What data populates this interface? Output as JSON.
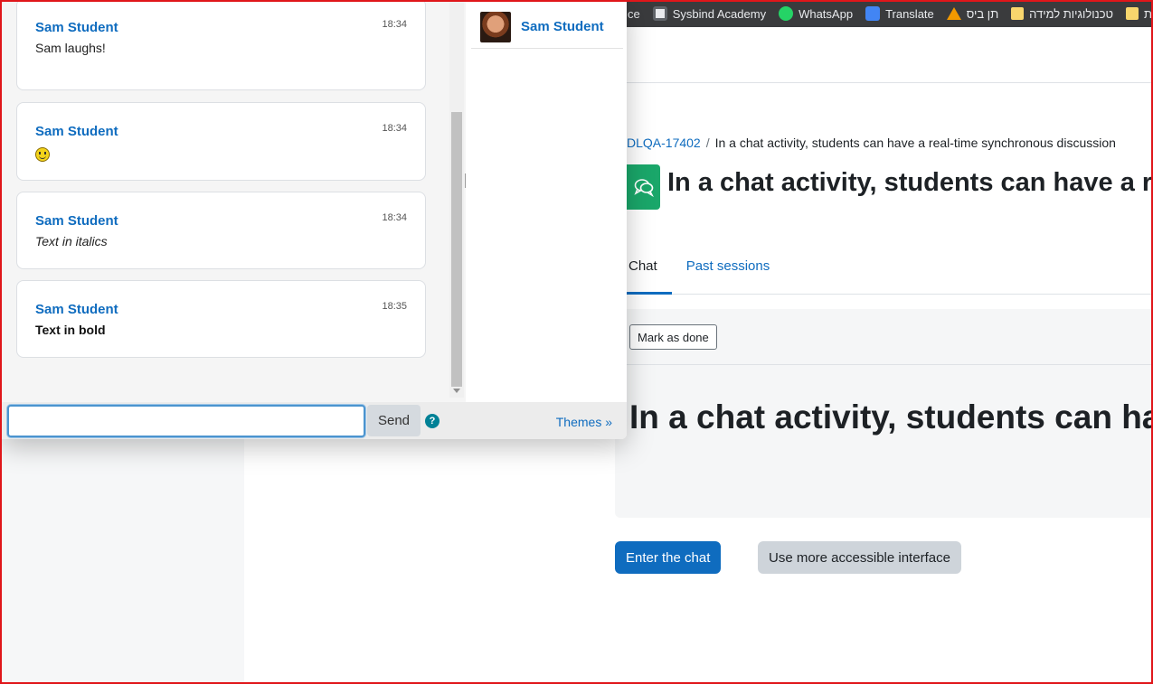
{
  "bookmarks": [
    {
      "label": "ce",
      "icon": "none"
    },
    {
      "label": "Sysbind Academy",
      "icon": "sysbind-icon"
    },
    {
      "label": "WhatsApp",
      "icon": "whatsapp-icon"
    },
    {
      "label": "Translate",
      "icon": "translate-icon"
    },
    {
      "label": "תן ביס",
      "icon": "tenbis-icon"
    },
    {
      "label": "טכנולוגיות למידה",
      "icon": "folder-icon"
    },
    {
      "label": "ת",
      "icon": "folder-icon"
    }
  ],
  "page": {
    "breadcrumb": {
      "course": "DLQA-17402",
      "separator": "/",
      "current": "In a chat activity, students can have a real-time synchronous discussion"
    },
    "title": "In a chat activity, students can have a real-time synchronous discussion",
    "tabs": [
      {
        "label": "Chat",
        "active": true
      },
      {
        "label": "Past sessions",
        "active": false
      }
    ],
    "mark_done_label": "Mark as done",
    "heading": "In a chat activity, students can have a real-time synchronous discussion",
    "enter_chat_label": "Enter the chat",
    "accessible_label": "Use more accessible interface"
  },
  "chat": {
    "messages": [
      {
        "author": "Sam Student",
        "time": "18:34",
        "text": "Sam laughs!",
        "style": "normal"
      },
      {
        "author": "Sam Student",
        "time": "18:34",
        "text": "",
        "style": "smiley"
      },
      {
        "author": "Sam Student",
        "time": "18:34",
        "text": "Text in italics",
        "style": "italic"
      },
      {
        "author": "Sam Student",
        "time": "18:35",
        "text": "Text in bold",
        "style": "bold"
      }
    ],
    "users": [
      {
        "name": "Sam Student"
      }
    ],
    "input_value": "",
    "send_label": "Send",
    "help_symbol": "?",
    "themes_label": "Themes »"
  },
  "colors": {
    "link": "#0f6cbf",
    "chat_icon": "#1aa76a",
    "frame": "#e0161a"
  }
}
